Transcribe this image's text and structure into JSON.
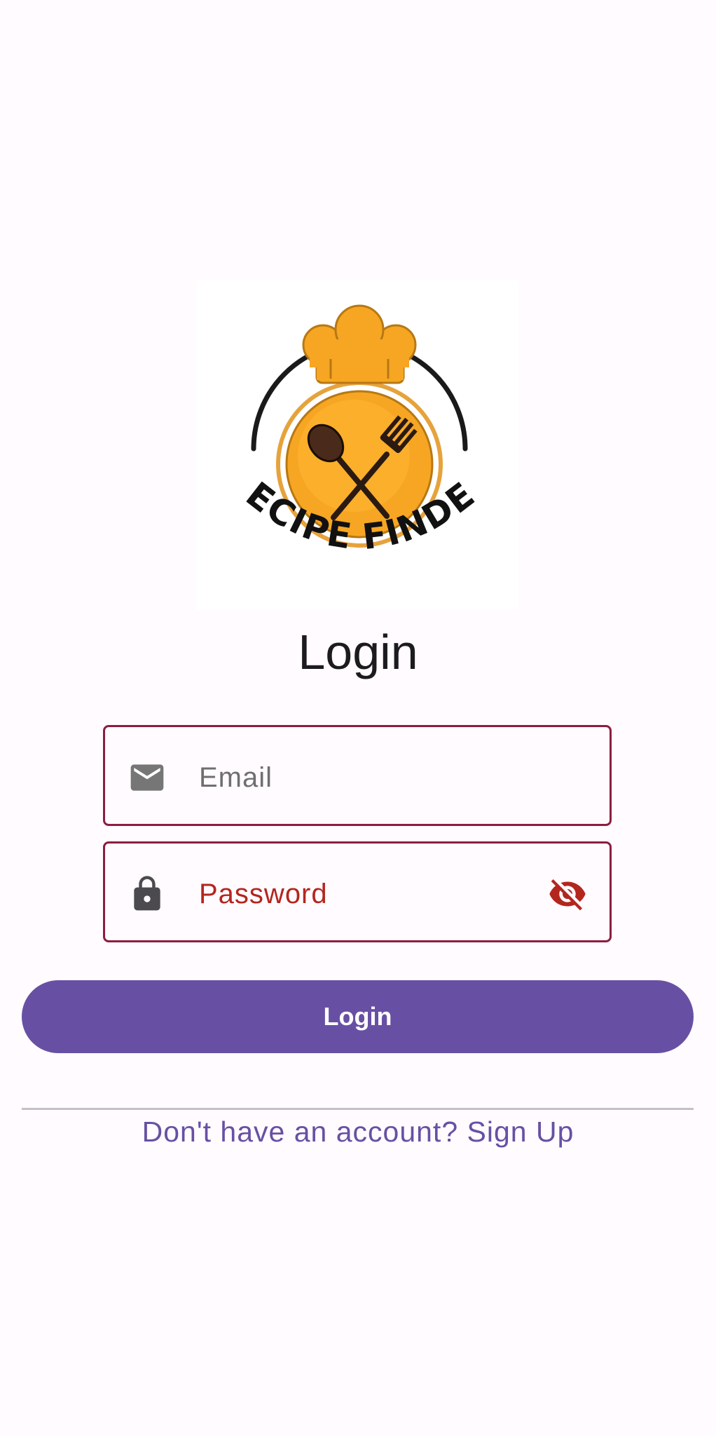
{
  "logo": {
    "text": "RECIPE FINDER",
    "icon": "chef-hat-spoon-fork-logo",
    "colors": {
      "orange": "#F5A623",
      "dark": "#111111"
    }
  },
  "page": {
    "title": "Login"
  },
  "form": {
    "email": {
      "placeholder": "Email",
      "value": "",
      "icon": "email-icon"
    },
    "password": {
      "placeholder": "Password",
      "value": "",
      "icon": "lock-icon",
      "toggle_icon": "eye-off-icon"
    },
    "login_label": "Login"
  },
  "footer": {
    "signup_text": "Don't have an account? Sign Up"
  },
  "colors": {
    "background": "#FFFBFE",
    "primary": "#6750A4",
    "outline": "#8C1D40",
    "error": "#B3261E"
  }
}
